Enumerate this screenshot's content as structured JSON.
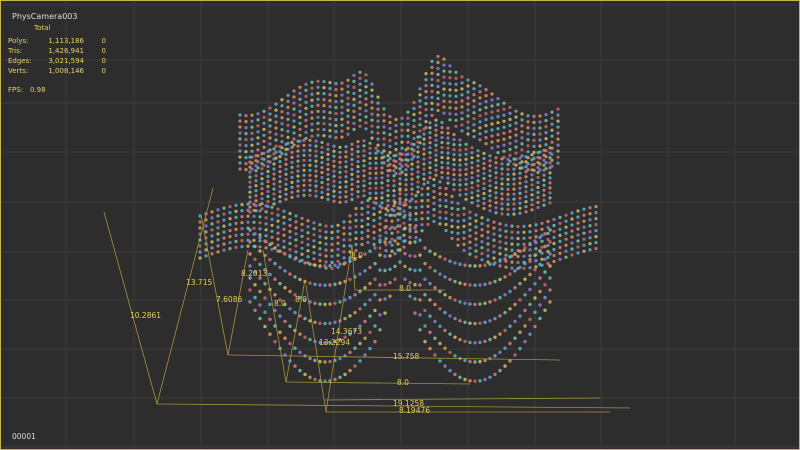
{
  "viewport": {
    "camera_name": "PhysCamera003",
    "frame": "00001",
    "stats": {
      "header": "Total",
      "rows": [
        {
          "label": "Polys:",
          "total": "1,113,186",
          "selected": "0"
        },
        {
          "label": "Tris:",
          "total": "1,426,941",
          "selected": "0"
        },
        {
          "label": "Edges:",
          "total": "3,021,594",
          "selected": "0"
        },
        {
          "label": "Verts:",
          "total": "1,008,146",
          "selected": "0"
        }
      ]
    },
    "fps": {
      "label": "FPS:",
      "value": "0.98"
    },
    "dimensions": [
      "10.2861",
      "13.715",
      "7.6086",
      "8.2013",
      "8.0",
      "8.0",
      "8.0",
      "8.0",
      "14.3673",
      "13.2294",
      "15.758",
      "8.0",
      "19.1258",
      "8.19476"
    ],
    "colors": {
      "border": "#c8b24a",
      "text": "#e7d06a",
      "grid": "#3a3a3a",
      "dim_line": "#b8a43c"
    }
  }
}
